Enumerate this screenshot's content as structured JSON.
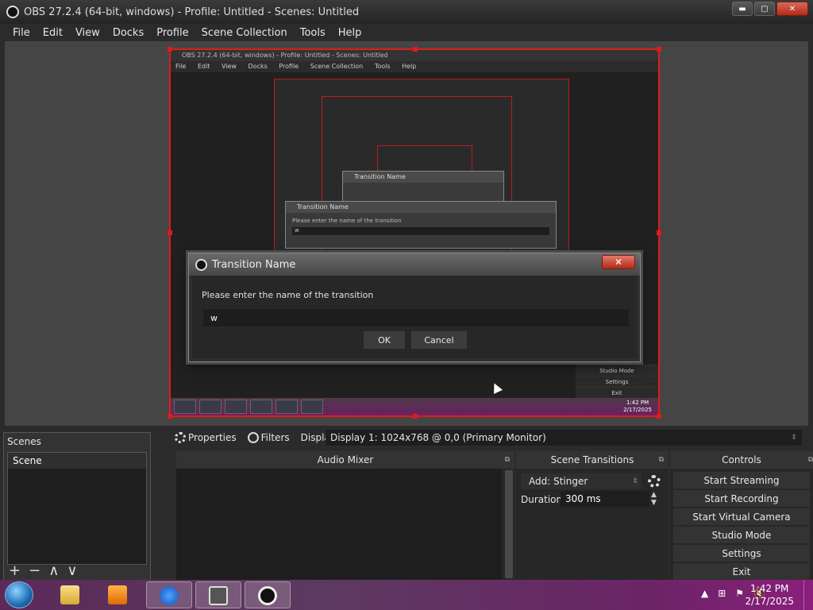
{
  "window": {
    "title": "OBS 27.2.4 (64-bit, windows) - Profile: Untitled - Scenes: Untitled",
    "minimize": "▬",
    "maximize": "▢",
    "close": "✕"
  },
  "menu": [
    "File",
    "Edit",
    "View",
    "Docks",
    "Profile",
    "Scene Collection",
    "Tools",
    "Help"
  ],
  "preview": {
    "nested_title": "OBS 27.2.4 (64-bit, windows) - Profile: Untitled - Scenes: Untitled",
    "nested_dialog_title": "Transition Name",
    "nested_dialog_label": "Please enter the name of the transition",
    "nested_dialog_value": "w",
    "nested_buttons": [
      "Studio Mode",
      "Settings",
      "Exit"
    ],
    "nested_clock_time": "1:42 PM",
    "nested_clock_date": "2/17/2025"
  },
  "dialog": {
    "title": "Transition Name",
    "close": "✕",
    "label": "Please enter the name of the transition",
    "input_value": "w",
    "ok": "OK",
    "cancel": "Cancel"
  },
  "toolbar": {
    "properties": "Properties",
    "filters": "Filters",
    "display_label": "Display",
    "display_value": "Display 1: 1024x768 @ 0,0 (Primary Monitor)"
  },
  "scenes": {
    "title": "Scenes",
    "items": [
      "Scene"
    ],
    "add": "+",
    "remove": "−",
    "up": "∧",
    "down": "∨"
  },
  "audio_mixer": {
    "title": "Audio Mixer"
  },
  "scene_transitions": {
    "title": "Scene Transitions",
    "selected": "Add: Stinger",
    "duration_label": "Duration",
    "duration_value": "300 ms"
  },
  "controls": {
    "title": "Controls",
    "buttons": [
      "Start Streaming",
      "Start Recording",
      "Start Virtual Camera",
      "Studio Mode",
      "Settings",
      "Exit"
    ]
  },
  "taskbar": {
    "time": "1:42 PM",
    "date": "2/17/2025"
  }
}
